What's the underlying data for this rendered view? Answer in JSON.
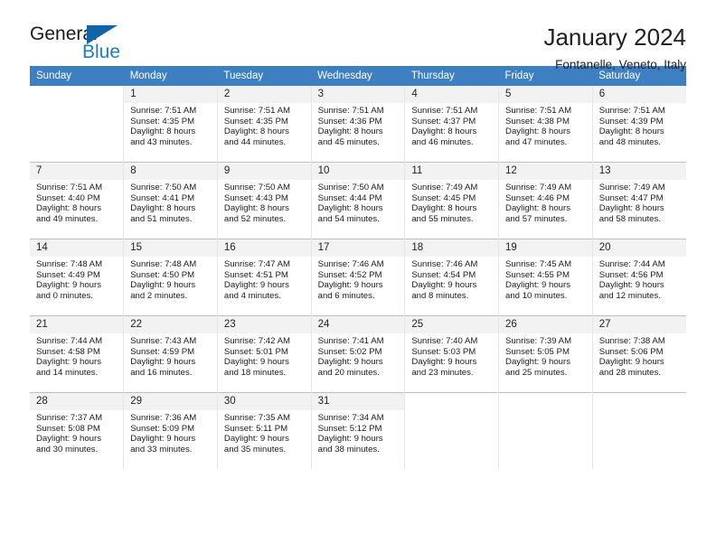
{
  "logo": {
    "word1": "General",
    "word2": "Blue",
    "triangle_color": "#1064a8",
    "blue_color": "#1f7dc4"
  },
  "header": {
    "title": "January 2024",
    "location": "Fontanelle, Veneto, Italy"
  },
  "theme": {
    "header_bg": "#3d7fc1",
    "header_text": "#ffffff",
    "daynum_bg": "#f2f2f2",
    "grid_line": "#bfbfbf"
  },
  "calendar": {
    "weekday_headers": [
      "Sunday",
      "Monday",
      "Tuesday",
      "Wednesday",
      "Thursday",
      "Friday",
      "Saturday"
    ],
    "weeks": [
      [
        {
          "empty": true
        },
        {
          "day": "1",
          "sunrise": "Sunrise: 7:51 AM",
          "sunset": "Sunset: 4:35 PM",
          "daylight1": "Daylight: 8 hours",
          "daylight2": "and 43 minutes."
        },
        {
          "day": "2",
          "sunrise": "Sunrise: 7:51 AM",
          "sunset": "Sunset: 4:35 PM",
          "daylight1": "Daylight: 8 hours",
          "daylight2": "and 44 minutes."
        },
        {
          "day": "3",
          "sunrise": "Sunrise: 7:51 AM",
          "sunset": "Sunset: 4:36 PM",
          "daylight1": "Daylight: 8 hours",
          "daylight2": "and 45 minutes."
        },
        {
          "day": "4",
          "sunrise": "Sunrise: 7:51 AM",
          "sunset": "Sunset: 4:37 PM",
          "daylight1": "Daylight: 8 hours",
          "daylight2": "and 46 minutes."
        },
        {
          "day": "5",
          "sunrise": "Sunrise: 7:51 AM",
          "sunset": "Sunset: 4:38 PM",
          "daylight1": "Daylight: 8 hours",
          "daylight2": "and 47 minutes."
        },
        {
          "day": "6",
          "sunrise": "Sunrise: 7:51 AM",
          "sunset": "Sunset: 4:39 PM",
          "daylight1": "Daylight: 8 hours",
          "daylight2": "and 48 minutes."
        }
      ],
      [
        {
          "day": "7",
          "sunrise": "Sunrise: 7:51 AM",
          "sunset": "Sunset: 4:40 PM",
          "daylight1": "Daylight: 8 hours",
          "daylight2": "and 49 minutes."
        },
        {
          "day": "8",
          "sunrise": "Sunrise: 7:50 AM",
          "sunset": "Sunset: 4:41 PM",
          "daylight1": "Daylight: 8 hours",
          "daylight2": "and 51 minutes."
        },
        {
          "day": "9",
          "sunrise": "Sunrise: 7:50 AM",
          "sunset": "Sunset: 4:43 PM",
          "daylight1": "Daylight: 8 hours",
          "daylight2": "and 52 minutes."
        },
        {
          "day": "10",
          "sunrise": "Sunrise: 7:50 AM",
          "sunset": "Sunset: 4:44 PM",
          "daylight1": "Daylight: 8 hours",
          "daylight2": "and 54 minutes."
        },
        {
          "day": "11",
          "sunrise": "Sunrise: 7:49 AM",
          "sunset": "Sunset: 4:45 PM",
          "daylight1": "Daylight: 8 hours",
          "daylight2": "and 55 minutes."
        },
        {
          "day": "12",
          "sunrise": "Sunrise: 7:49 AM",
          "sunset": "Sunset: 4:46 PM",
          "daylight1": "Daylight: 8 hours",
          "daylight2": "and 57 minutes."
        },
        {
          "day": "13",
          "sunrise": "Sunrise: 7:49 AM",
          "sunset": "Sunset: 4:47 PM",
          "daylight1": "Daylight: 8 hours",
          "daylight2": "and 58 minutes."
        }
      ],
      [
        {
          "day": "14",
          "sunrise": "Sunrise: 7:48 AM",
          "sunset": "Sunset: 4:49 PM",
          "daylight1": "Daylight: 9 hours",
          "daylight2": "and 0 minutes."
        },
        {
          "day": "15",
          "sunrise": "Sunrise: 7:48 AM",
          "sunset": "Sunset: 4:50 PM",
          "daylight1": "Daylight: 9 hours",
          "daylight2": "and 2 minutes."
        },
        {
          "day": "16",
          "sunrise": "Sunrise: 7:47 AM",
          "sunset": "Sunset: 4:51 PM",
          "daylight1": "Daylight: 9 hours",
          "daylight2": "and 4 minutes."
        },
        {
          "day": "17",
          "sunrise": "Sunrise: 7:46 AM",
          "sunset": "Sunset: 4:52 PM",
          "daylight1": "Daylight: 9 hours",
          "daylight2": "and 6 minutes."
        },
        {
          "day": "18",
          "sunrise": "Sunrise: 7:46 AM",
          "sunset": "Sunset: 4:54 PM",
          "daylight1": "Daylight: 9 hours",
          "daylight2": "and 8 minutes."
        },
        {
          "day": "19",
          "sunrise": "Sunrise: 7:45 AM",
          "sunset": "Sunset: 4:55 PM",
          "daylight1": "Daylight: 9 hours",
          "daylight2": "and 10 minutes."
        },
        {
          "day": "20",
          "sunrise": "Sunrise: 7:44 AM",
          "sunset": "Sunset: 4:56 PM",
          "daylight1": "Daylight: 9 hours",
          "daylight2": "and 12 minutes."
        }
      ],
      [
        {
          "day": "21",
          "sunrise": "Sunrise: 7:44 AM",
          "sunset": "Sunset: 4:58 PM",
          "daylight1": "Daylight: 9 hours",
          "daylight2": "and 14 minutes."
        },
        {
          "day": "22",
          "sunrise": "Sunrise: 7:43 AM",
          "sunset": "Sunset: 4:59 PM",
          "daylight1": "Daylight: 9 hours",
          "daylight2": "and 16 minutes."
        },
        {
          "day": "23",
          "sunrise": "Sunrise: 7:42 AM",
          "sunset": "Sunset: 5:01 PM",
          "daylight1": "Daylight: 9 hours",
          "daylight2": "and 18 minutes."
        },
        {
          "day": "24",
          "sunrise": "Sunrise: 7:41 AM",
          "sunset": "Sunset: 5:02 PM",
          "daylight1": "Daylight: 9 hours",
          "daylight2": "and 20 minutes."
        },
        {
          "day": "25",
          "sunrise": "Sunrise: 7:40 AM",
          "sunset": "Sunset: 5:03 PM",
          "daylight1": "Daylight: 9 hours",
          "daylight2": "and 23 minutes."
        },
        {
          "day": "26",
          "sunrise": "Sunrise: 7:39 AM",
          "sunset": "Sunset: 5:05 PM",
          "daylight1": "Daylight: 9 hours",
          "daylight2": "and 25 minutes."
        },
        {
          "day": "27",
          "sunrise": "Sunrise: 7:38 AM",
          "sunset": "Sunset: 5:06 PM",
          "daylight1": "Daylight: 9 hours",
          "daylight2": "and 28 minutes."
        }
      ],
      [
        {
          "day": "28",
          "sunrise": "Sunrise: 7:37 AM",
          "sunset": "Sunset: 5:08 PM",
          "daylight1": "Daylight: 9 hours",
          "daylight2": "and 30 minutes."
        },
        {
          "day": "29",
          "sunrise": "Sunrise: 7:36 AM",
          "sunset": "Sunset: 5:09 PM",
          "daylight1": "Daylight: 9 hours",
          "daylight2": "and 33 minutes."
        },
        {
          "day": "30",
          "sunrise": "Sunrise: 7:35 AM",
          "sunset": "Sunset: 5:11 PM",
          "daylight1": "Daylight: 9 hours",
          "daylight2": "and 35 minutes."
        },
        {
          "day": "31",
          "sunrise": "Sunrise: 7:34 AM",
          "sunset": "Sunset: 5:12 PM",
          "daylight1": "Daylight: 9 hours",
          "daylight2": "and 38 minutes."
        },
        {
          "empty": true
        },
        {
          "empty": true
        },
        {
          "empty": true
        }
      ]
    ]
  }
}
